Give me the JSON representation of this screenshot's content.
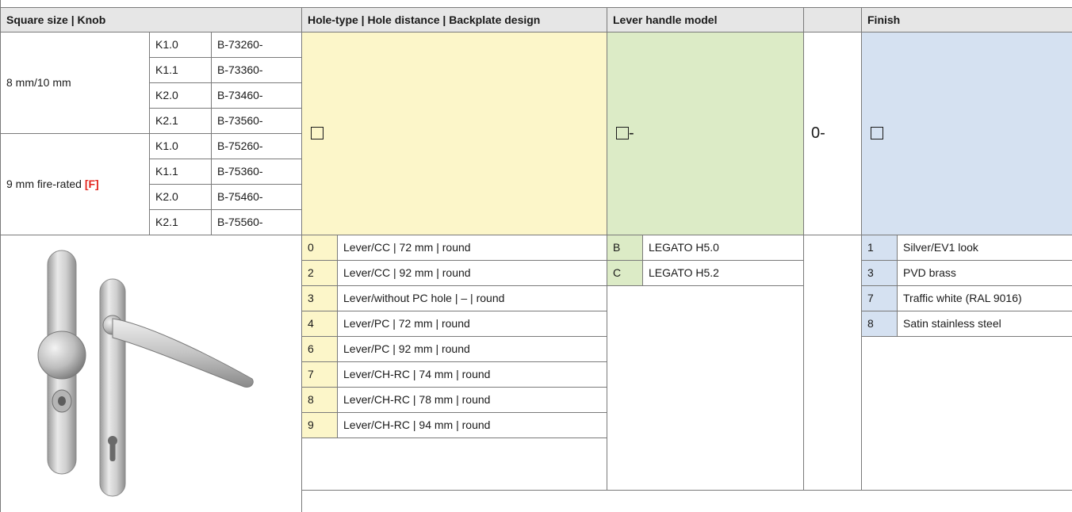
{
  "header": {
    "col_square_knob": "Square size | Knob",
    "col_hole": "Hole-type | Hole distance | Backplate design",
    "col_lever": "Lever handle model",
    "col_finish": "Finish"
  },
  "square_groups": [
    {
      "label": "8 mm/10 mm",
      "flag": "",
      "rows": [
        {
          "knob": "K1.0",
          "code": "B-73260-"
        },
        {
          "knob": "K1.1",
          "code": "B-73360-"
        },
        {
          "knob": "K2.0",
          "code": "B-73460-"
        },
        {
          "knob": "K2.1",
          "code": "B-73560-"
        }
      ]
    },
    {
      "label": "9 mm fire-rated",
      "flag": "[F]",
      "rows": [
        {
          "knob": "K1.0",
          "code": "B-75260-"
        },
        {
          "knob": "K1.1",
          "code": "B-75360-"
        },
        {
          "knob": "K2.0",
          "code": "B-75460-"
        },
        {
          "knob": "K2.1",
          "code": "B-75560-"
        }
      ]
    }
  ],
  "config": {
    "lever_suffix": "-",
    "fixed_code": "0-"
  },
  "hole_options": [
    {
      "code": "0",
      "label": "Lever/CC | 72 mm | round"
    },
    {
      "code": "2",
      "label": "Lever/CC | 92 mm | round"
    },
    {
      "code": "3",
      "label": "Lever/without PC hole | – | round"
    },
    {
      "code": "4",
      "label": "Lever/PC | 72 mm | round"
    },
    {
      "code": "6",
      "label": "Lever/PC | 92 mm | round"
    },
    {
      "code": "7",
      "label": "Lever/CH-RC | 74 mm | round"
    },
    {
      "code": "8",
      "label": "Lever/CH-RC | 78 mm | round"
    },
    {
      "code": "9",
      "label": "Lever/CH-RC | 94 mm | round"
    }
  ],
  "lever_options": [
    {
      "code": "B",
      "label": "LEGATO H5.0"
    },
    {
      "code": "C",
      "label": "LEGATO H5.2"
    }
  ],
  "finish_options": [
    {
      "code": "1",
      "label": "Silver/EV1 look"
    },
    {
      "code": "3",
      "label": "PVD brass"
    },
    {
      "code": "7",
      "label": "Traffic white (RAL 9016)"
    },
    {
      "code": "8",
      "label": "Satin stainless steel"
    }
  ],
  "colors": {
    "header_bg": "#e6e6e6",
    "hole_bg": "#fcf6c9",
    "lever_bg": "#dcebc6",
    "finish_bg": "#d5e1f1",
    "flag_red": "#e3251d"
  }
}
